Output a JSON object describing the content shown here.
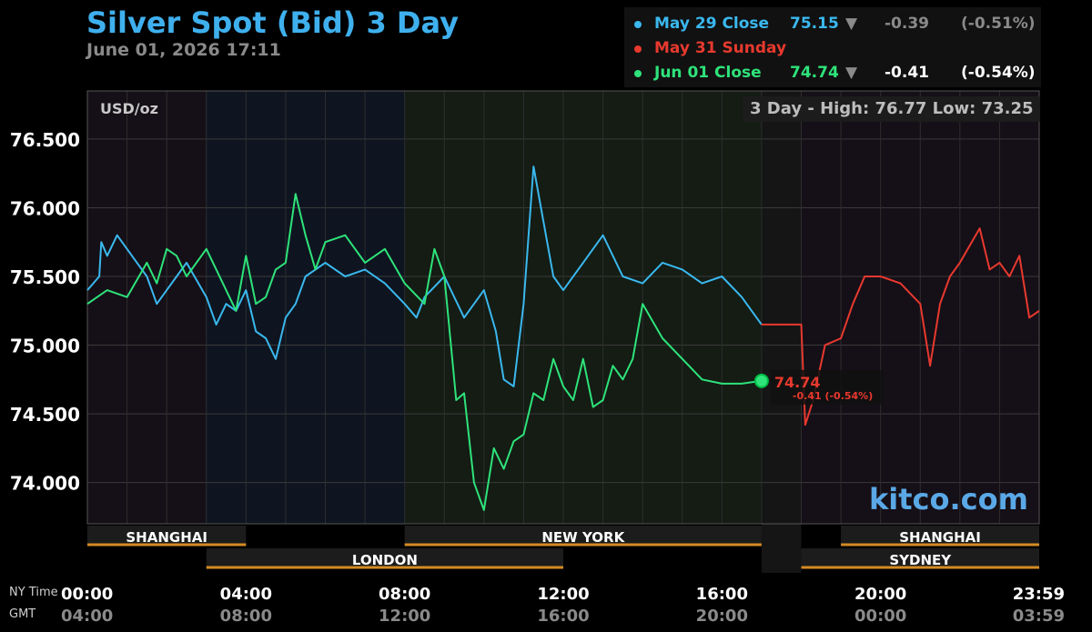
{
  "title": "Silver Spot (Bid) 3 Day",
  "subtitle": "June 01, 2026 17:11",
  "legend": [
    {
      "label": "May 29 Close",
      "value": "75.15",
      "arrow": "▼",
      "change": "-0.39",
      "pct": "(-0.51%)",
      "color": "#3ab8ee",
      "textColor": "#3ab8ee",
      "numColor": "#3ab8ee",
      "chgColor": "#8a8a8a"
    },
    {
      "label": "May 31 Sunday",
      "value": "",
      "arrow": "",
      "change": "",
      "pct": "",
      "color": "#e8392e",
      "textColor": "#e8392e",
      "numColor": "#e8392e",
      "chgColor": "#e8392e"
    },
    {
      "label": "Jun 01 Close",
      "value": "74.74",
      "arrow": "▼",
      "change": "-0.41",
      "pct": "(-0.54%)",
      "color": "#2ee37a",
      "textColor": "#2ee37a",
      "numColor": "#2ee37a",
      "chgColor": "#ffffff"
    }
  ],
  "unit_label": "USD/oz",
  "high_low": "3 Day - High: 76.77  Low: 73.25",
  "watermark": "kitco.com",
  "last_price": {
    "value": "74.74",
    "change": "-0.41 (-0.54%)"
  },
  "chart_data": {
    "type": "line",
    "ylim": [
      73.7,
      76.85
    ],
    "yticks": [
      "76.500",
      "76.000",
      "75.500",
      "75.000",
      "74.500",
      "74.000"
    ],
    "ytick_values": [
      76.5,
      76.0,
      75.5,
      75.0,
      74.5,
      74.0
    ],
    "xlim_hours": [
      0,
      24
    ],
    "ny_time_label": "NY Time",
    "gmt_label": "GMT",
    "xticks": [
      {
        "h": 0,
        "ny": "00:00",
        "gmt": "04:00"
      },
      {
        "h": 4,
        "ny": "04:00",
        "gmt": "08:00"
      },
      {
        "h": 8,
        "ny": "08:00",
        "gmt": "12:00"
      },
      {
        "h": 12,
        "ny": "12:00",
        "gmt": "16:00"
      },
      {
        "h": 16,
        "ny": "16:00",
        "gmt": "20:00"
      },
      {
        "h": 20,
        "ny": "20:00",
        "gmt": "00:00"
      },
      {
        "h": 24,
        "ny": "23:59",
        "gmt": "03:59"
      }
    ],
    "sessions_top": [
      {
        "name": "SHANGHAI",
        "start": 0,
        "end": 4
      },
      {
        "name": "NEW YORK",
        "start": 8,
        "end": 17
      },
      {
        "name": "SHANGHAI",
        "start": 19,
        "end": 24
      }
    ],
    "sessions_bottom": [
      {
        "name": "LONDON",
        "start": 3,
        "end": 12
      },
      {
        "name": "SYDNEY",
        "start": 18,
        "end": 24
      }
    ],
    "series": [
      {
        "name": "May 29 Close",
        "color": "#3ab8ee",
        "x": [
          0,
          0.3,
          0.35,
          0.5,
          0.75,
          1,
          1.25,
          1.5,
          1.75,
          2,
          2.25,
          2.5,
          3,
          3.25,
          3.5,
          3.75,
          4,
          4.25,
          4.5,
          4.75,
          5,
          5.25,
          5.5,
          6,
          6.5,
          7,
          7.5,
          8,
          8.3,
          8.5,
          9,
          9.5,
          10,
          10.3,
          10.5,
          10.75,
          11,
          11.25,
          11.5,
          11.75,
          12,
          12.5,
          13,
          13.5,
          14,
          14.5,
          15,
          15.5,
          16,
          16.5,
          17
        ],
        "y": [
          75.4,
          75.5,
          75.75,
          75.65,
          75.8,
          75.7,
          75.6,
          75.5,
          75.3,
          75.4,
          75.5,
          75.6,
          75.35,
          75.15,
          75.3,
          75.25,
          75.4,
          75.1,
          75.05,
          74.9,
          75.2,
          75.3,
          75.5,
          75.6,
          75.5,
          75.55,
          75.45,
          75.3,
          75.2,
          75.35,
          75.5,
          75.2,
          75.4,
          75.1,
          74.75,
          74.7,
          75.3,
          76.3,
          75.9,
          75.5,
          75.4,
          75.6,
          75.8,
          75.5,
          75.45,
          75.6,
          75.55,
          75.45,
          75.5,
          75.35,
          75.15
        ]
      },
      {
        "name": "May 31 Sunday",
        "color": "#e8392e",
        "x": [
          17,
          18,
          18.1,
          18.3,
          18.6,
          19,
          19.3,
          19.6,
          20,
          20.5,
          21,
          21.25,
          21.5,
          21.75,
          22,
          22.5,
          22.75,
          23,
          23.25,
          23.5,
          23.75,
          24
        ],
        "y": [
          75.15,
          75.15,
          74.42,
          74.6,
          75.0,
          75.05,
          75.3,
          75.5,
          75.5,
          75.45,
          75.3,
          74.85,
          75.3,
          75.5,
          75.6,
          75.85,
          75.55,
          75.6,
          75.5,
          75.65,
          75.2,
          75.25
        ]
      },
      {
        "name": "Jun 01 Close",
        "color": "#2ee37a",
        "x": [
          0,
          0.5,
          1,
          1.5,
          1.75,
          2,
          2.25,
          2.5,
          3,
          3.5,
          3.75,
          4,
          4.25,
          4.5,
          4.75,
          5,
          5.25,
          5.5,
          5.75,
          6,
          6.5,
          7,
          7.5,
          8,
          8.5,
          8.75,
          9,
          9.2,
          9.3,
          9.5,
          9.75,
          10,
          10.25,
          10.5,
          10.75,
          11,
          11.25,
          11.5,
          11.75,
          12,
          12.25,
          12.5,
          12.75,
          13,
          13.25,
          13.5,
          13.75,
          14,
          14.5,
          15,
          15.5,
          16,
          16.5,
          17
        ],
        "y": [
          75.3,
          75.4,
          75.35,
          75.6,
          75.45,
          75.7,
          75.65,
          75.5,
          75.7,
          75.4,
          75.25,
          75.65,
          75.3,
          75.35,
          75.55,
          75.6,
          76.1,
          75.8,
          75.55,
          75.75,
          75.8,
          75.6,
          75.7,
          75.45,
          75.3,
          75.7,
          75.5,
          74.9,
          74.6,
          74.65,
          74.0,
          73.8,
          74.25,
          74.1,
          74.3,
          74.35,
          74.65,
          74.6,
          74.9,
          74.7,
          74.6,
          74.9,
          74.55,
          74.6,
          74.85,
          74.75,
          74.9,
          75.3,
          75.05,
          74.9,
          74.75,
          74.72,
          74.72,
          74.74
        ]
      }
    ]
  }
}
